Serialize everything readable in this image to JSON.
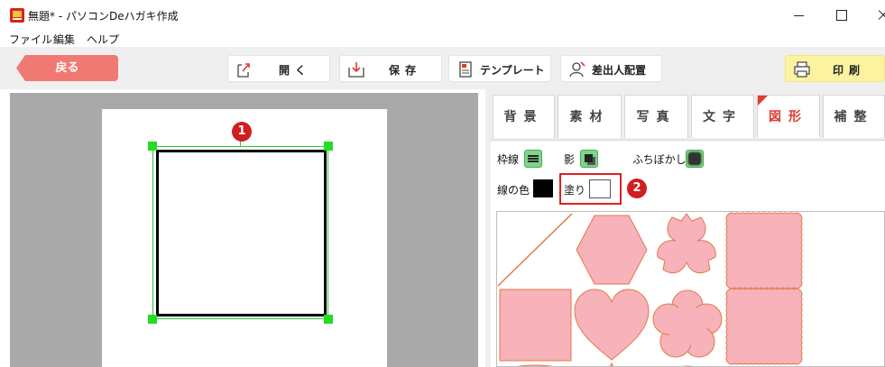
{
  "window": {
    "title": "無題* - パソコンDeハガキ作成"
  },
  "menu": {
    "items": [
      "ファイル",
      "編集",
      "ヘルプ"
    ]
  },
  "toolbar": {
    "back_label": "戻る",
    "open_label": "開く",
    "save_label": "保存",
    "template_label": "テンプレート",
    "sender_label": "差出人配置",
    "print_label": "印刷"
  },
  "annotations": {
    "marker_1": "1",
    "marker_2": "2",
    "marker_color": "#d01e22"
  },
  "tabs": {
    "background": "背景",
    "material": "素材",
    "photo": "写真",
    "text": "文字",
    "shape": "図形",
    "adjust": "補整",
    "active": "図形"
  },
  "shape_options": {
    "border_label": "枠線",
    "shadow_label": "影",
    "blur_label": "ふちぼかし",
    "line_color_label": "線の色",
    "line_color": "#000000",
    "fill_label": "塗り",
    "fill_color": "#ffffff"
  },
  "gallery": {
    "shape_fill": "#f7b2ba",
    "shape_stroke": "#e07a48",
    "shapes": [
      "diagonal-line",
      "hexagon",
      "cherry-blossom",
      "scalloped-square",
      "square",
      "heart",
      "flower",
      "scalloped-square"
    ]
  },
  "colors": {
    "back_button": "#f07a73",
    "print_button": "#fbf3a0",
    "selection": "#22dd22",
    "active_tab": "#e03b30"
  }
}
